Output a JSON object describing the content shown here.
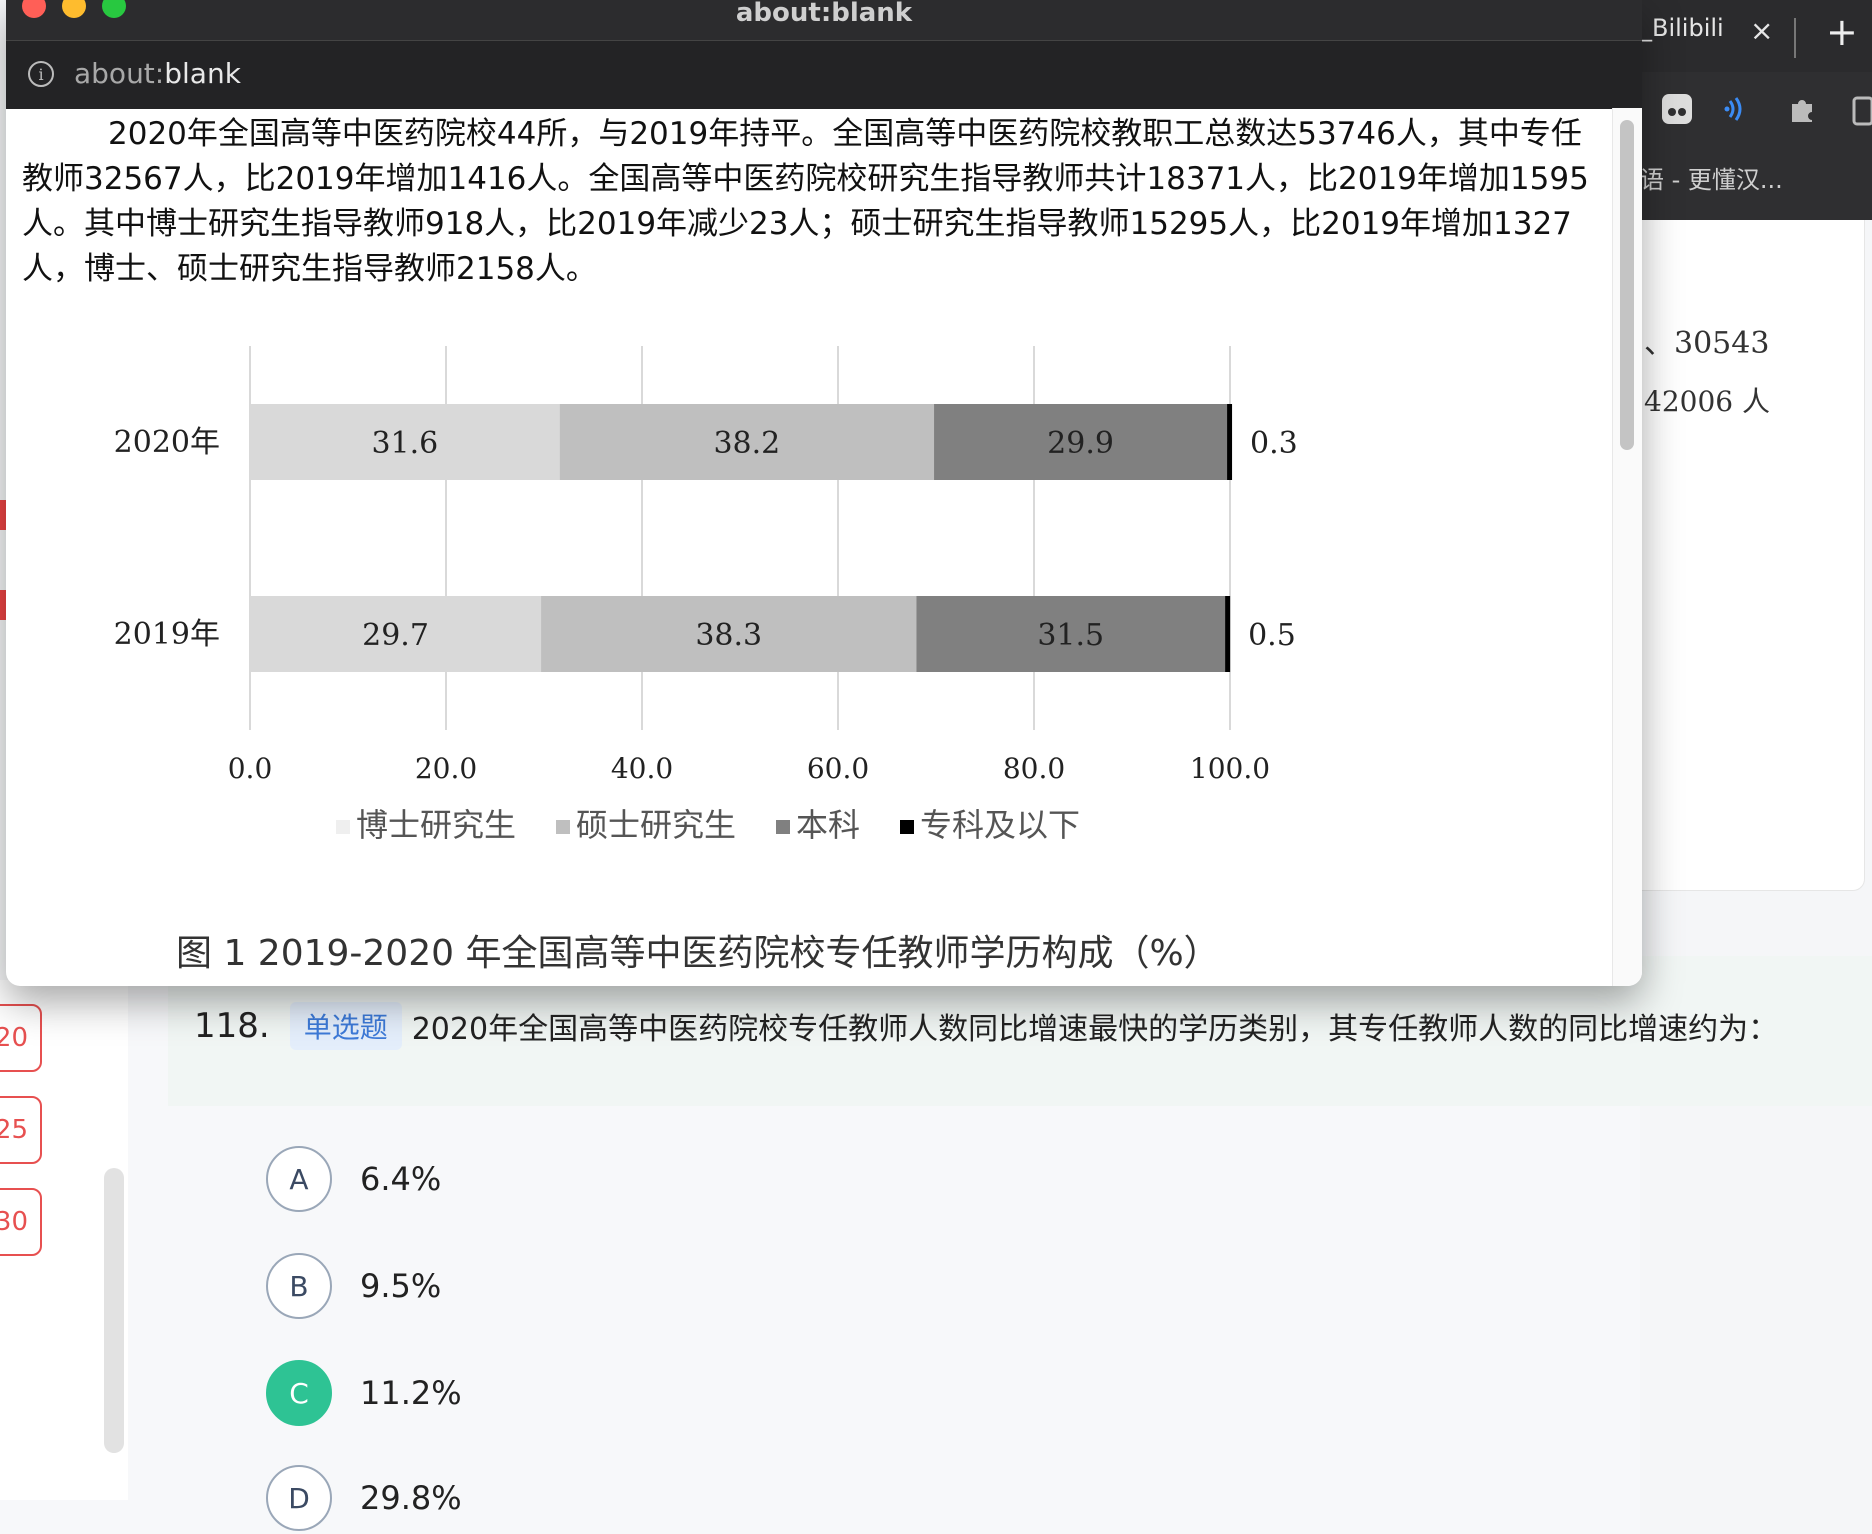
{
  "background_browser": {
    "tab_title": "_Bilibili",
    "tab_close": "×",
    "new_tab": "+",
    "toolbar_text": "语 - 更懂汉...",
    "card_text_1": "、30543",
    "card_text_2": "42006 人"
  },
  "popup": {
    "title": "about:blank",
    "address": {
      "scheme": "about:",
      "path": "blank"
    }
  },
  "article": {
    "paragraph": "2020年全国高等中医药院校44所，与2019年持平。全国高等中医药院校教职工总数达53746人，其中专任教师32567人，比2019年增加1416人。全国高等中医药院校研究生指导教师共计18371人，比2019年增加1595人。其中博士研究生指导教师918人，比2019年减少23人；硕士研究生指导教师15295人，比2019年增加1327人，博士、硕士研究生指导教师2158人。",
    "caption": "图 1    2019-2020 年全国高等中医药院校专任教师学历构成（%）"
  },
  "chart_data": {
    "type": "bar",
    "orientation": "horizontal",
    "stacked": true,
    "categories": [
      "2020年",
      "2019年"
    ],
    "series": [
      {
        "name": "博士研究生",
        "values": [
          31.6,
          29.7
        ],
        "color": "#d9d9d9"
      },
      {
        "name": "硕士研究生",
        "values": [
          38.2,
          38.3
        ],
        "color": "#bfbfbf"
      },
      {
        "name": "本科",
        "values": [
          29.9,
          31.5
        ],
        "color": "#808080"
      },
      {
        "name": "专科及以下",
        "values": [
          0.3,
          0.5
        ],
        "color": "#000000"
      }
    ],
    "x_ticks": [
      "0.0",
      "20.0",
      "40.0",
      "60.0",
      "80.0",
      "100.0"
    ],
    "xlim": [
      0,
      100
    ],
    "grid": true,
    "legend_position": "bottom"
  },
  "question": {
    "number": "118.",
    "type_tag": "单选题",
    "text": "2020年全国高等中医药院校专任教师人数同比增速最快的学历类别，其专任教师人数的同比增速约为："
  },
  "options": [
    {
      "letter": "A",
      "text": "6.4%",
      "selected": false
    },
    {
      "letter": "B",
      "text": "9.5%",
      "selected": false
    },
    {
      "letter": "C",
      "text": "11.2%",
      "selected": true
    },
    {
      "letter": "D",
      "text": "29.8%",
      "selected": false
    }
  ],
  "answer_card": [
    "20",
    "25",
    "30"
  ],
  "colors": {
    "accent_green": "#2ec394",
    "tag_blue": "#3d7ad8",
    "answer_red": "#e75050"
  }
}
